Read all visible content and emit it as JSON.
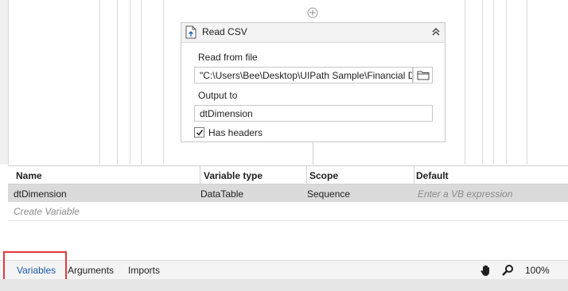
{
  "activity": {
    "title": "Read CSV",
    "icon": "read-csv-icon",
    "read_from_label": "Read from file",
    "read_from_value": "\"C:\\Users\\Bee\\Desktop\\UIPath Sample\\Financial D",
    "output_label": "Output to",
    "output_value": "dtDimension",
    "has_headers_label": "Has headers",
    "has_headers_checked": true
  },
  "variables": {
    "columns": [
      "Name",
      "Variable type",
      "Scope",
      "Default"
    ],
    "rows": [
      {
        "name": "dtDimension",
        "type": "DataTable",
        "scope": "Sequence",
        "default": "Enter a VB expression"
      }
    ],
    "create_label": "Create Variable"
  },
  "bottom_tabs": {
    "variables": "Variables",
    "arguments": "Arguments",
    "imports": "Imports",
    "zoom": "100%"
  },
  "colors": {
    "highlight": "#e0393e",
    "tab_active": "#1a5aa8",
    "row_selected": "#dadada"
  }
}
